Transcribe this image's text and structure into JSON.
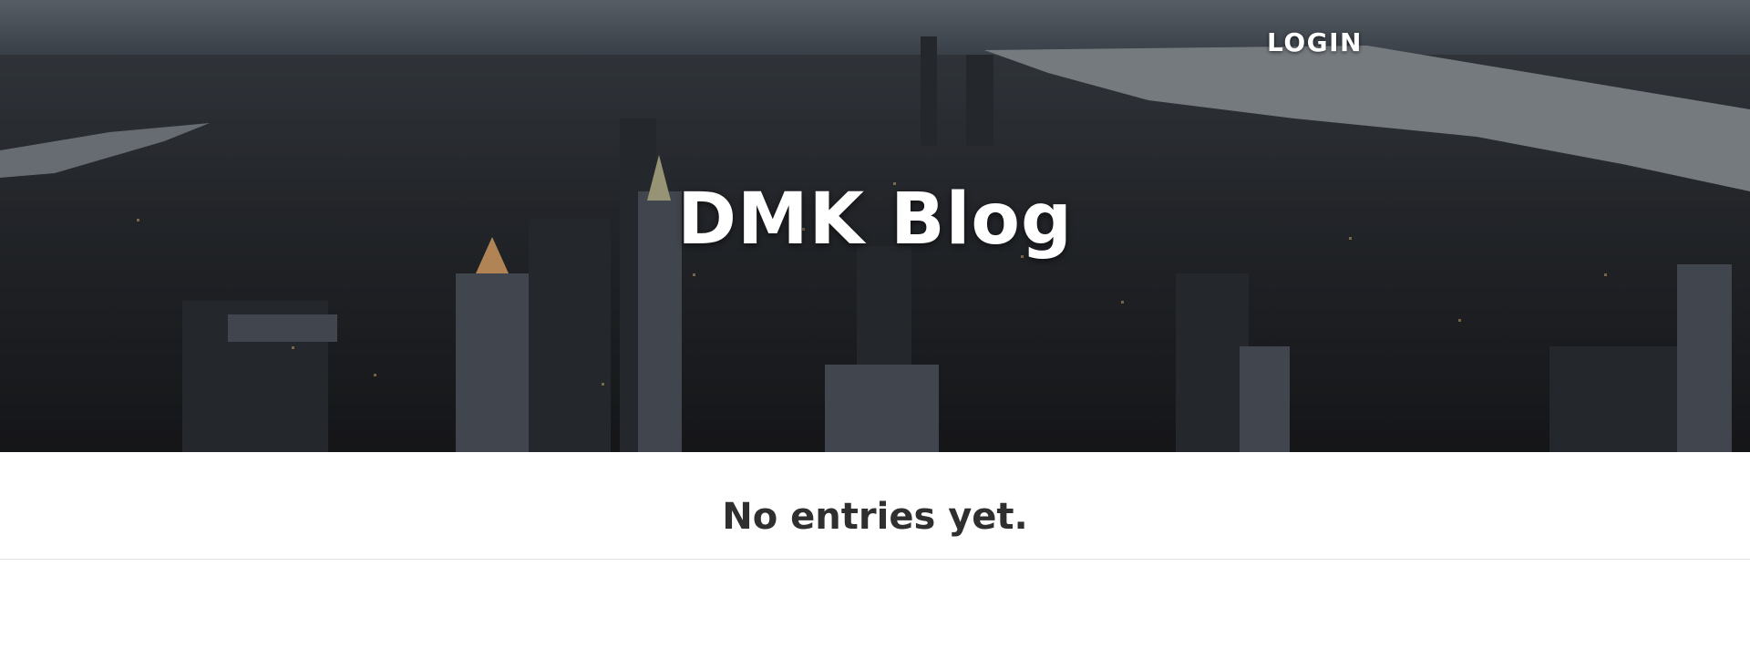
{
  "header": {
    "nav_login": "LOGIN",
    "site_title": "DMK Blog"
  },
  "main": {
    "empty_message": "No entries yet."
  }
}
